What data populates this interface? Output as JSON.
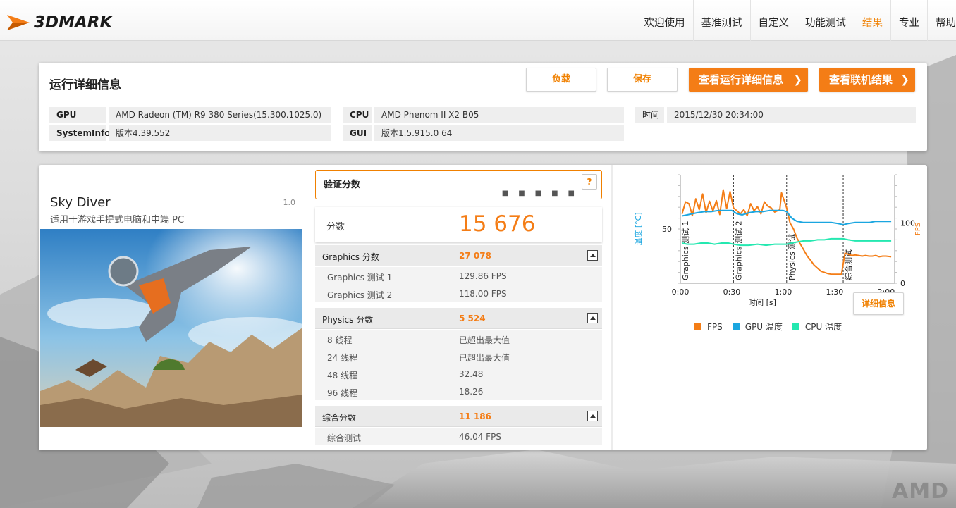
{
  "app": {
    "brand": "3DMARK"
  },
  "nav": {
    "items": [
      {
        "label": "欢迎使用"
      },
      {
        "label": "基准测试"
      },
      {
        "label": "自定义"
      },
      {
        "label": "功能测试"
      },
      {
        "label": "结果",
        "active": true
      },
      {
        "label": "专业"
      },
      {
        "label": "帮助"
      }
    ]
  },
  "details": {
    "title": "运行详细信息",
    "load_label": "负载",
    "save_label": "保存",
    "view_details_label": "查看运行详细信息",
    "view_online_label": "查看联机结果",
    "gpu_key": "GPU",
    "gpu_val": "AMD Radeon (TM) R9 380 Series(15.300.1025.0)",
    "sysinfo_key": "SystemInfo",
    "sysinfo_val": "版本4.39.552",
    "cpu_key": "CPU",
    "cpu_val": "AMD Phenom II X2 B05",
    "gui_key": "GUI",
    "gui_val": "版本1.5.915.0 64",
    "time_key": "时间",
    "time_val": "2015/12/30 20:34:00"
  },
  "benchmark": {
    "name": "Sky Diver",
    "version": "1.0",
    "subtitle": "适用于游戏手提式电脑和中端 PC"
  },
  "verify": {
    "label": "验证分数",
    "help": "?"
  },
  "score": {
    "label": "分数",
    "value": "15 676"
  },
  "sections": {
    "graphics": {
      "label": "Graphics 分数",
      "value": "27 078",
      "rows": [
        {
          "label": "Graphics 测试 1",
          "value": "129.86 FPS"
        },
        {
          "label": "Graphics 测试 2",
          "value": "118.00 FPS"
        }
      ]
    },
    "physics": {
      "label": "Physics 分数",
      "value": "5 524",
      "rows": [
        {
          "label": "8 线程",
          "value": "已超出最大值"
        },
        {
          "label": "24 线程",
          "value": "已超出最大值"
        },
        {
          "label": "48 线程",
          "value": "32.48"
        },
        {
          "label": "96 线程",
          "value": "18.26"
        }
      ]
    },
    "combined": {
      "label": "综合分数",
      "value": "11 186",
      "rows": [
        {
          "label": "综合测试",
          "value": "46.04 FPS"
        }
      ]
    }
  },
  "chart_data": {
    "type": "line",
    "xlabel": "时间 [s]",
    "ylabel_left": "温度 [°C]",
    "ylabel_right": "FPS",
    "x_ticks": [
      "0:00",
      "0:30",
      "1:00",
      "1:30",
      "2:00"
    ],
    "y_left_ticks": [
      50
    ],
    "y_right_ticks": [
      100,
      0
    ],
    "x_range_seconds": [
      0,
      125
    ],
    "y_left_range": [
      0,
      100
    ],
    "y_right_range": [
      0,
      180
    ],
    "phases": [
      {
        "label": "Graphics 测试 1",
        "start": 0
      },
      {
        "label": "Graphics 测试 2",
        "start": 31
      },
      {
        "label": "Physics 测试",
        "start": 62
      },
      {
        "label": "综合测试",
        "start": 95
      }
    ],
    "series": [
      {
        "name": "FPS",
        "axis": "right",
        "color": "#f47d16",
        "points": [
          [
            1,
            115
          ],
          [
            3,
            135
          ],
          [
            5,
            132
          ],
          [
            7,
            112
          ],
          [
            9,
            140
          ],
          [
            11,
            122
          ],
          [
            13,
            148
          ],
          [
            15,
            117
          ],
          [
            17,
            136
          ],
          [
            19,
            120
          ],
          [
            21,
            137
          ],
          [
            23,
            114
          ],
          [
            25,
            155
          ],
          [
            27,
            124
          ],
          [
            29,
            152
          ],
          [
            31,
            125
          ],
          [
            33,
            120
          ],
          [
            35,
            115
          ],
          [
            37,
            122
          ],
          [
            39,
            112
          ],
          [
            41,
            132
          ],
          [
            43,
            120
          ],
          [
            45,
            127
          ],
          [
            47,
            115
          ],
          [
            49,
            135
          ],
          [
            51,
            128
          ],
          [
            53,
            125
          ],
          [
            55,
            118
          ],
          [
            58,
            122
          ],
          [
            59,
            150
          ],
          [
            62,
            125
          ],
          [
            64,
            100
          ],
          [
            66,
            90
          ],
          [
            68,
            75
          ],
          [
            70,
            65
          ],
          [
            72,
            55
          ],
          [
            74,
            45
          ],
          [
            76,
            38
          ],
          [
            78,
            30
          ],
          [
            80,
            25
          ],
          [
            82,
            20
          ],
          [
            84,
            18
          ],
          [
            86,
            16
          ],
          [
            88,
            15
          ],
          [
            90,
            15
          ],
          [
            92,
            15
          ],
          [
            94,
            15
          ],
          [
            96,
            50
          ],
          [
            98,
            48
          ],
          [
            100,
            46
          ],
          [
            102,
            47
          ],
          [
            104,
            46
          ],
          [
            106,
            45
          ],
          [
            108,
            46
          ],
          [
            110,
            45
          ],
          [
            112,
            45
          ],
          [
            114,
            46
          ],
          [
            116,
            44
          ],
          [
            118,
            45
          ],
          [
            120,
            45
          ],
          [
            123,
            44
          ]
        ]
      },
      {
        "name": "GPU 温度",
        "axis": "left",
        "color": "#1aa6e0",
        "points": [
          [
            1,
            62
          ],
          [
            4,
            63
          ],
          [
            7,
            64
          ],
          [
            10,
            65
          ],
          [
            14,
            66
          ],
          [
            18,
            66
          ],
          [
            22,
            67
          ],
          [
            26,
            67
          ],
          [
            30,
            67
          ],
          [
            33,
            64
          ],
          [
            36,
            63
          ],
          [
            40,
            65
          ],
          [
            44,
            66
          ],
          [
            48,
            66
          ],
          [
            52,
            67
          ],
          [
            56,
            67
          ],
          [
            60,
            67
          ],
          [
            62,
            66
          ],
          [
            65,
            60
          ],
          [
            68,
            57
          ],
          [
            72,
            56
          ],
          [
            76,
            56
          ],
          [
            80,
            56
          ],
          [
            84,
            56
          ],
          [
            88,
            56
          ],
          [
            92,
            55
          ],
          [
            95,
            54
          ],
          [
            98,
            55
          ],
          [
            102,
            56
          ],
          [
            106,
            56
          ],
          [
            110,
            56
          ],
          [
            114,
            57
          ],
          [
            118,
            57
          ],
          [
            123,
            57
          ]
        ]
      },
      {
        "name": "CPU 温度",
        "axis": "left",
        "color": "#24e8b0",
        "points": [
          [
            1,
            37
          ],
          [
            4,
            36
          ],
          [
            8,
            36
          ],
          [
            12,
            37
          ],
          [
            16,
            37
          ],
          [
            20,
            36
          ],
          [
            24,
            37
          ],
          [
            28,
            37
          ],
          [
            31,
            36
          ],
          [
            35,
            35
          ],
          [
            40,
            35
          ],
          [
            45,
            36
          ],
          [
            50,
            35
          ],
          [
            55,
            36
          ],
          [
            60,
            36
          ],
          [
            62,
            36
          ],
          [
            65,
            37
          ],
          [
            68,
            38
          ],
          [
            72,
            39
          ],
          [
            76,
            39
          ],
          [
            80,
            40
          ],
          [
            84,
            40
          ],
          [
            88,
            41
          ],
          [
            92,
            41
          ],
          [
            95,
            41
          ],
          [
            98,
            40
          ],
          [
            102,
            39
          ],
          [
            106,
            39
          ],
          [
            110,
            39
          ],
          [
            114,
            39
          ],
          [
            118,
            39
          ],
          [
            123,
            39
          ]
        ]
      }
    ]
  },
  "legend": {
    "fps": {
      "label": "FPS",
      "color": "#f47d16"
    },
    "gpu": {
      "label": "GPU 温度",
      "color": "#1aa6e0"
    },
    "cpu": {
      "label": "CPU 温度",
      "color": "#24e8b0"
    }
  },
  "chart_detail_label": "详细信息",
  "watermark": "AMD"
}
